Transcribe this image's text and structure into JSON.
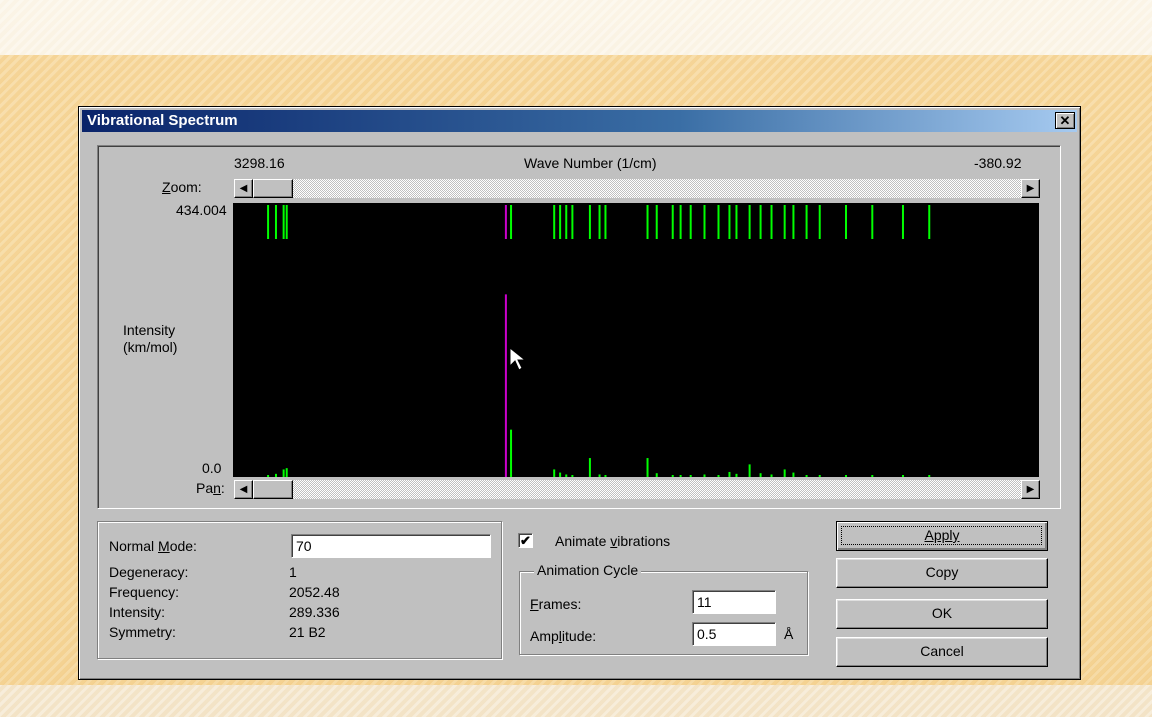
{
  "window": {
    "title": "Vibrational Spectrum",
    "close_glyph": "✕"
  },
  "spectrum": {
    "x_left_label": "3298.16",
    "x_axis_title": "Wave Number (1/cm)",
    "x_right_label": "-380.92",
    "zoom_label": "Zoom:",
    "pan_label": "Pan:",
    "y_max_label": "434.004",
    "y_min_label": "0.0",
    "y_axis_title_line1": "Intensity",
    "y_axis_title_line2": "(km/mol)",
    "colors": {
      "lines": "#00ff00",
      "selected": "#cc00cc",
      "background": "#000000"
    }
  },
  "chart_data": {
    "type": "bar",
    "xlabel": "Wave Number (1/cm)",
    "ylabel": "Intensity (km/mol)",
    "xlim": [
      3298.16,
      -380.92
    ],
    "ylim": [
      0,
      434.004
    ],
    "selected_mode": {
      "x": 2052.48,
      "y": 289.336
    },
    "peaks": [
      {
        "x": 3138,
        "y": 2
      },
      {
        "x": 3102,
        "y": 5
      },
      {
        "x": 3067,
        "y": 12
      },
      {
        "x": 3053,
        "y": 14
      },
      {
        "x": 2052.48,
        "y": 289.336
      },
      {
        "x": 2029,
        "y": 75
      },
      {
        "x": 1832,
        "y": 12
      },
      {
        "x": 1805,
        "y": 7
      },
      {
        "x": 1777,
        "y": 4
      },
      {
        "x": 1749,
        "y": 3
      },
      {
        "x": 1669,
        "y": 30
      },
      {
        "x": 1625,
        "y": 4
      },
      {
        "x": 1598,
        "y": 3
      },
      {
        "x": 1406,
        "y": 30
      },
      {
        "x": 1364,
        "y": 6
      },
      {
        "x": 1291,
        "y": 3
      },
      {
        "x": 1255,
        "y": 2
      },
      {
        "x": 1209,
        "y": 3
      },
      {
        "x": 1146,
        "y": 4
      },
      {
        "x": 1082,
        "y": 3
      },
      {
        "x": 1032,
        "y": 8
      },
      {
        "x": 1000,
        "y": 5
      },
      {
        "x": 940,
        "y": 20
      },
      {
        "x": 890,
        "y": 6
      },
      {
        "x": 840,
        "y": 4
      },
      {
        "x": 780,
        "y": 12
      },
      {
        "x": 740,
        "y": 7
      },
      {
        "x": 680,
        "y": 3
      },
      {
        "x": 620,
        "y": 2
      },
      {
        "x": 500,
        "y": 3
      },
      {
        "x": 380,
        "y": 2
      },
      {
        "x": 240,
        "y": 2
      },
      {
        "x": 120,
        "y": 1
      }
    ]
  },
  "info": {
    "normal_mode_label": "Normal Mode:",
    "normal_mode_value": "70",
    "degeneracy_label": "Degeneracy:",
    "degeneracy_value": "1",
    "frequency_label": "Frequency:",
    "frequency_value": "2052.48",
    "intensity_label": "Intensity:",
    "intensity_value": "289.336",
    "symmetry_label": "Symmetry:",
    "symmetry_value": "21 B2"
  },
  "animation": {
    "animate_label": "Animate vibrations",
    "animate_checked": "✔",
    "cycle_title": "Animation Cycle",
    "frames_label": "Frames:",
    "frames_value": "11",
    "amplitude_label": "Amplitude:",
    "amplitude_value": "0.5",
    "amplitude_unit": "Å"
  },
  "buttons": {
    "apply": "Apply",
    "copy": "Copy",
    "ok": "OK",
    "cancel": "Cancel"
  }
}
